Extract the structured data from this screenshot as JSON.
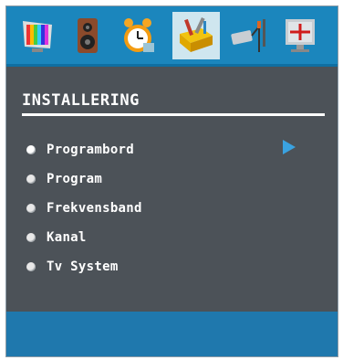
{
  "menu": {
    "title": "INSTALLERING",
    "items": [
      {
        "label": "Programbord"
      },
      {
        "label": "Program"
      },
      {
        "label": "Frekvensband"
      },
      {
        "label": "Kanal"
      },
      {
        "label": "Tv System"
      }
    ]
  },
  "icons": [
    {
      "name": "picture-icon"
    },
    {
      "name": "sound-icon"
    },
    {
      "name": "timer-icon"
    },
    {
      "name": "installation-icon",
      "selected": true
    },
    {
      "name": "source-icon"
    },
    {
      "name": "pc-position-icon"
    }
  ],
  "colors": {
    "header_blue": "#1b86bd",
    "panel_gray": "#4c5258",
    "footer_blue": "#1f78ad",
    "arrow_blue": "#3aa2e0"
  }
}
